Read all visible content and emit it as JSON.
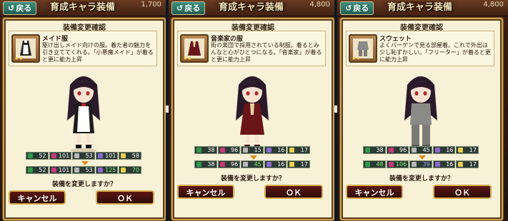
{
  "panels": [
    {
      "topbar": {
        "back": "戻る",
        "title": "育成キャラ装備",
        "coins": "1,700"
      },
      "dialog": {
        "title": "装備変更確認",
        "item": {
          "name": "メイド服",
          "desc": "駆け出しメイド向けの服。着た者の魅力を引き立ててくれる。「小悪魔メイド」が着ると更に能力上昇",
          "stars": "★★"
        },
        "stats_before": [
          "52",
          "101",
          "53",
          "101",
          "58"
        ],
        "stats_after": [
          "52",
          "101",
          "53",
          "125",
          "70"
        ],
        "question": "装備を変更しますか？",
        "cancel": "キャンセル",
        "ok": "ＯＫ"
      },
      "outfit": "maid"
    },
    {
      "topbar": {
        "back": "戻る",
        "title": "育成キャラ装備",
        "coins": "4,800"
      },
      "dialog": {
        "title": "装備変更確認",
        "item": {
          "name": "音楽家の服",
          "desc": "街の楽団で採用されている制服。着るとみんなと心がひとつになる。「音楽家」が着ると更に能力上昇",
          "stars": "★★"
        },
        "stats_before": [
          "38",
          "96",
          "15",
          "16",
          "17"
        ],
        "stats_after": [
          "38",
          "96",
          "45",
          "16",
          "17"
        ],
        "question": "装備を変更しますか？",
        "cancel": "キャンセル",
        "ok": "ＯＫ"
      },
      "outfit": "musician"
    },
    {
      "topbar": {
        "back": "戻る",
        "title": "育成キャラ装備",
        "coins": "4,800"
      },
      "dialog": {
        "title": "装備変更確認",
        "item": {
          "name": "スウェット",
          "desc": "よくバーゲンで見る部屋着。これで外出は少し恥ずかしい。「フリーター」が着ると更に能力上昇",
          "stars": "★★"
        },
        "stats_before": [
          "38",
          "96",
          "45",
          "16",
          "17"
        ],
        "stats_after": [
          "48",
          "106",
          "39",
          "16",
          "17"
        ],
        "question": "装備を変更しますか？",
        "cancel": "キャンセル",
        "ok": "ＯＫ"
      },
      "outfit": "sweat"
    }
  ],
  "colors": {
    "dialog_bg": "#f7f1d7",
    "dialog_border": "#c9a451",
    "button_bg": "#5b1712",
    "stat_up": "#7cf57c",
    "stat_down": "#9aa3ff"
  },
  "stat_icons": [
    "attack-gem-icon",
    "sword-icon",
    "heart-icon",
    "shield-icon",
    "star-icon"
  ]
}
